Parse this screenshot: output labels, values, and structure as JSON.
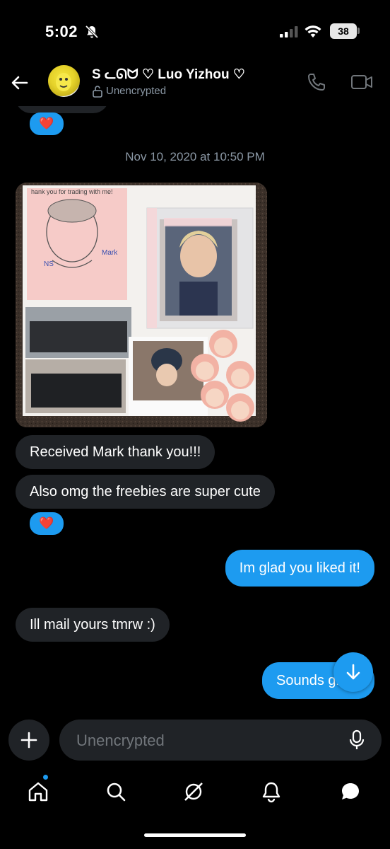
{
  "status_bar": {
    "time": "5:02",
    "battery": "38"
  },
  "header": {
    "contact_name": "S ᓚᘏᗢ ♡ Luo Yizhou ♡",
    "encryption": "Unencrypted"
  },
  "messages": {
    "reaction": "❤️",
    "timestamp": "Nov 10, 2020 at 10:50 PM",
    "photo_note": "hank you for trading with me!",
    "photo_label_left": "NS",
    "photo_label_right": "Mark",
    "received_1": "Received Mark thank you!!!",
    "received_2": "Also omg the freebies are super cute",
    "sent_1": "Im glad you liked it!",
    "received_3": "Ill mail yours tmrw :)",
    "sent_2": "Sounds great"
  },
  "composer": {
    "placeholder": "Unencrypted"
  },
  "tabs": [
    "home",
    "search",
    "grok",
    "notifications",
    "messages"
  ],
  "colors": {
    "accent": "#1d9bf0",
    "bubble_in": "#202327",
    "background": "#000000"
  }
}
